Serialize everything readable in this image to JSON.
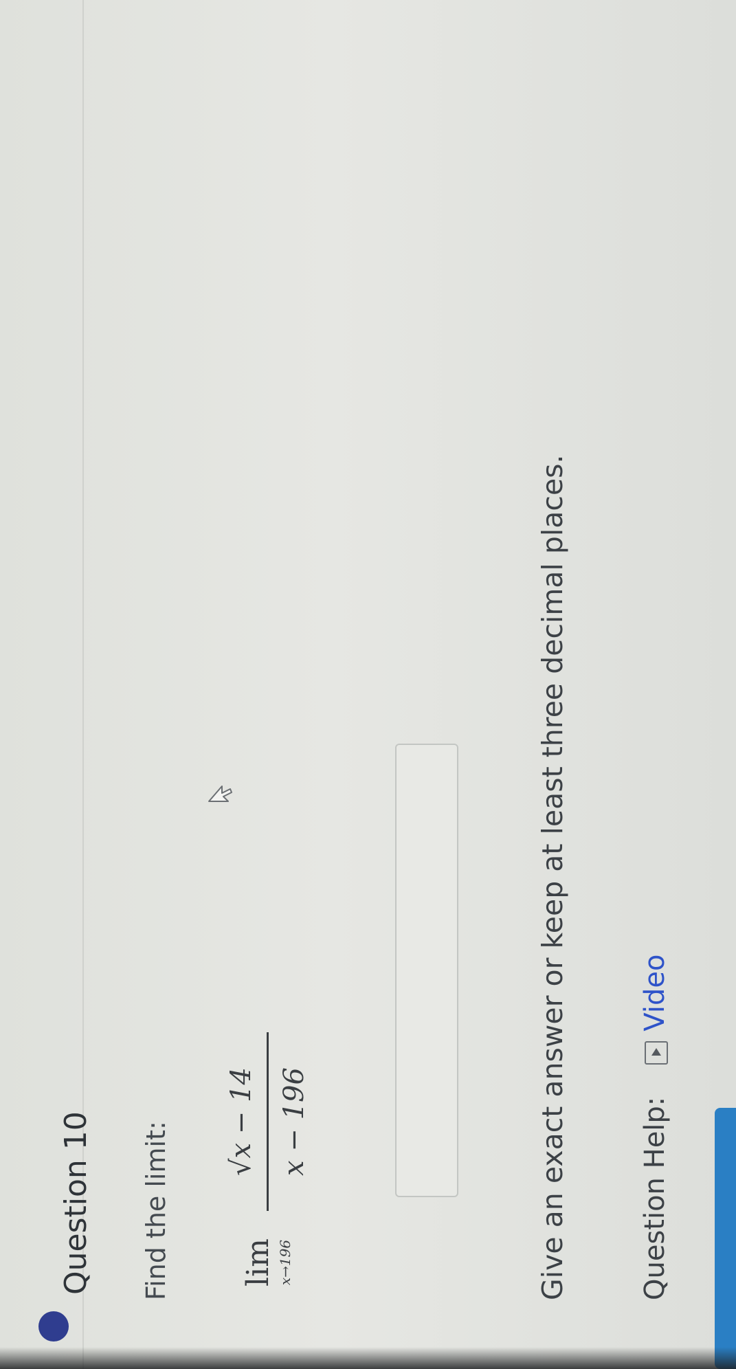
{
  "question": {
    "title": "Question 10",
    "status_color": "#2f3d8f",
    "status_icon": "filled-circle-icon"
  },
  "problem": {
    "prompt": "Find the limit:",
    "limit_word": "lim",
    "limit_subscript": "x→196",
    "numerator": "√x − 14",
    "denominator": "x − 196"
  },
  "answer": {
    "value": "",
    "placeholder": ""
  },
  "instruction": "Give an exact answer or keep at least three decimal places.",
  "help": {
    "label": "Question Help:",
    "video_label": "Video",
    "video_icon": "play-video-icon"
  },
  "colors": {
    "link": "#2e53c9",
    "submit": "#2a7fc4"
  }
}
